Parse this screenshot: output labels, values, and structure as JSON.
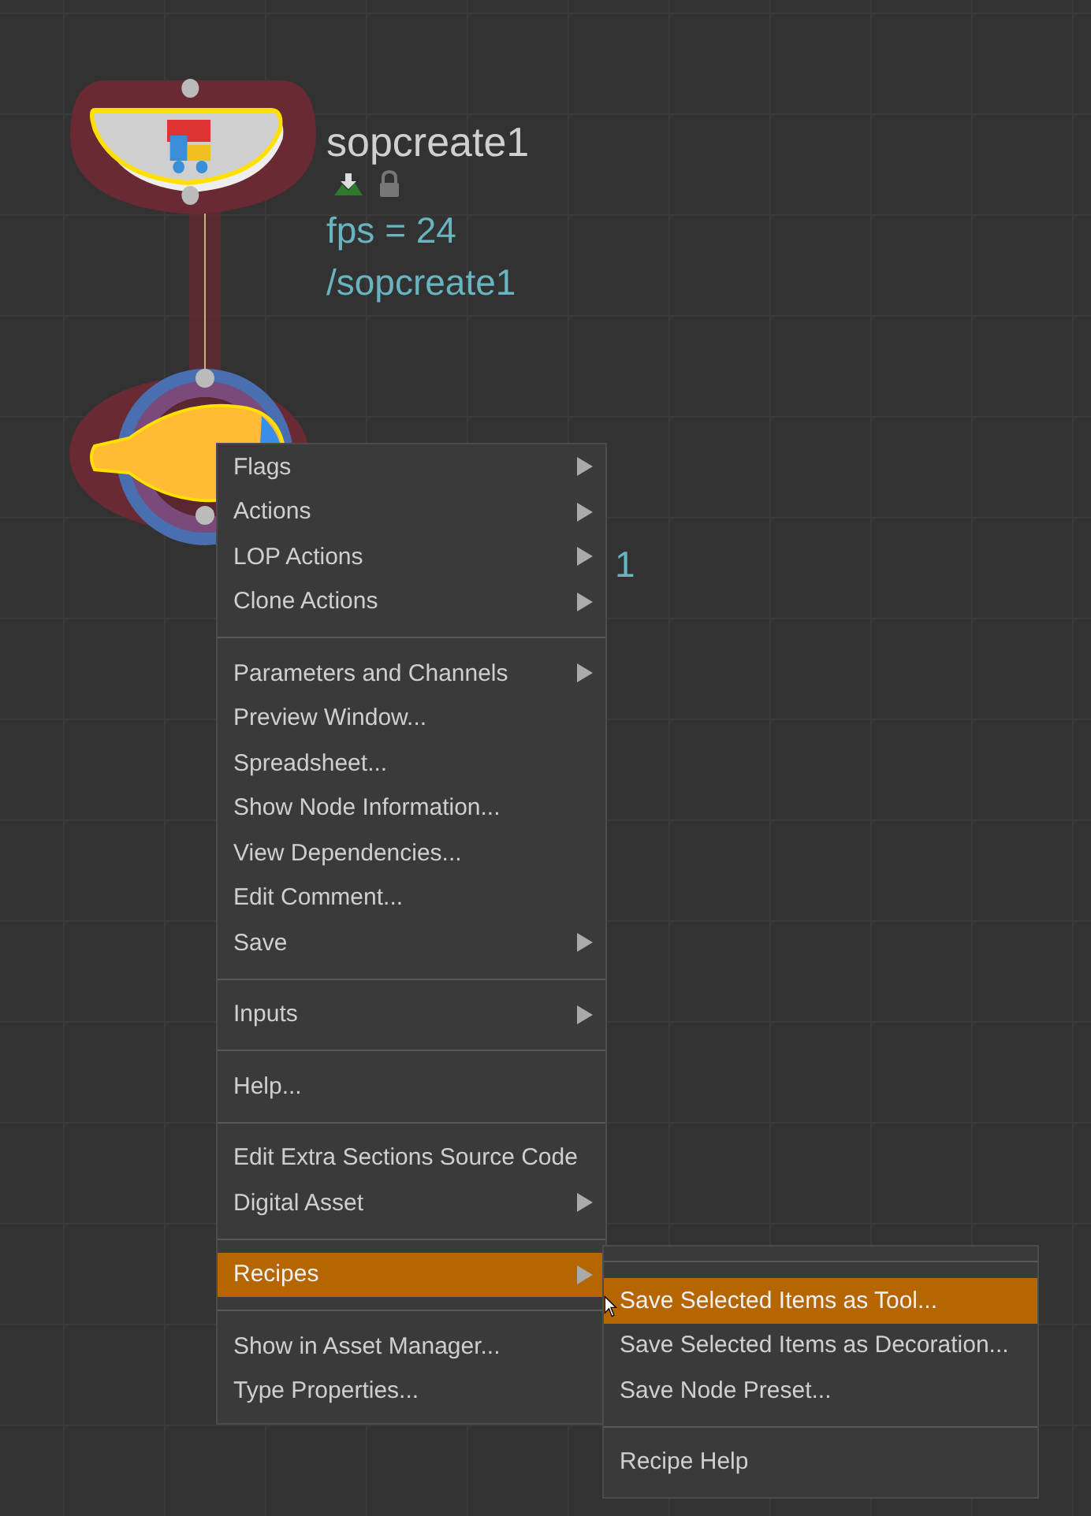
{
  "nodes": [
    {
      "kind": "sop",
      "name": "sopcreate1",
      "flags": true,
      "info": [
        "fps = 24",
        "/sopcreate1"
      ]
    },
    {
      "kind": "light",
      "info": [
        "1"
      ]
    }
  ],
  "menu": {
    "items": [
      {
        "kind": "item",
        "label": "Flags",
        "submenu": true,
        "selected": false
      },
      {
        "kind": "item",
        "label": "Actions",
        "submenu": true,
        "selected": false
      },
      {
        "kind": "item",
        "label": "LOP Actions",
        "submenu": true,
        "selected": false
      },
      {
        "kind": "item",
        "label": "Clone Actions",
        "submenu": true,
        "selected": false
      },
      {
        "kind": "separator"
      },
      {
        "kind": "item",
        "label": "Parameters and Channels",
        "submenu": true,
        "selected": false
      },
      {
        "kind": "item",
        "label": "Preview Window...",
        "submenu": false,
        "selected": false
      },
      {
        "kind": "item",
        "label": "Spreadsheet...",
        "submenu": false,
        "selected": false
      },
      {
        "kind": "item",
        "label": "Show Node Information...",
        "submenu": false,
        "selected": false
      },
      {
        "kind": "item",
        "label": "View Dependencies...",
        "submenu": false,
        "selected": false
      },
      {
        "kind": "item",
        "label": "Edit Comment...",
        "submenu": false,
        "selected": false
      },
      {
        "kind": "item",
        "label": "Save",
        "submenu": true,
        "selected": false
      },
      {
        "kind": "separator"
      },
      {
        "kind": "item",
        "label": "Inputs",
        "submenu": true,
        "selected": false
      },
      {
        "kind": "separator"
      },
      {
        "kind": "item",
        "label": "Help...",
        "submenu": false,
        "selected": false
      },
      {
        "kind": "separator"
      },
      {
        "kind": "item",
        "label": "Edit Extra Sections Source Code",
        "submenu": false,
        "selected": false
      },
      {
        "kind": "item",
        "label": "Digital Asset",
        "submenu": true,
        "selected": false
      },
      {
        "kind": "separator"
      },
      {
        "kind": "item",
        "label": "Recipes",
        "submenu": true,
        "selected": true
      },
      {
        "kind": "separator"
      },
      {
        "kind": "item",
        "label": "Show in Asset Manager...",
        "submenu": false,
        "selected": false
      },
      {
        "kind": "item",
        "label": "Type Properties...",
        "submenu": false,
        "selected": false
      }
    ]
  },
  "submenu": {
    "items": [
      {
        "kind": "separator"
      },
      {
        "kind": "item",
        "label": "Save Selected Items as Tool...",
        "selected": true
      },
      {
        "kind": "item",
        "label": "Save Selected Items as Decoration...",
        "selected": false
      },
      {
        "kind": "item",
        "label": "Save Node Preset...",
        "selected": false
      },
      {
        "kind": "separator"
      },
      {
        "kind": "item",
        "label": "Recipe Help",
        "selected": false
      }
    ]
  }
}
